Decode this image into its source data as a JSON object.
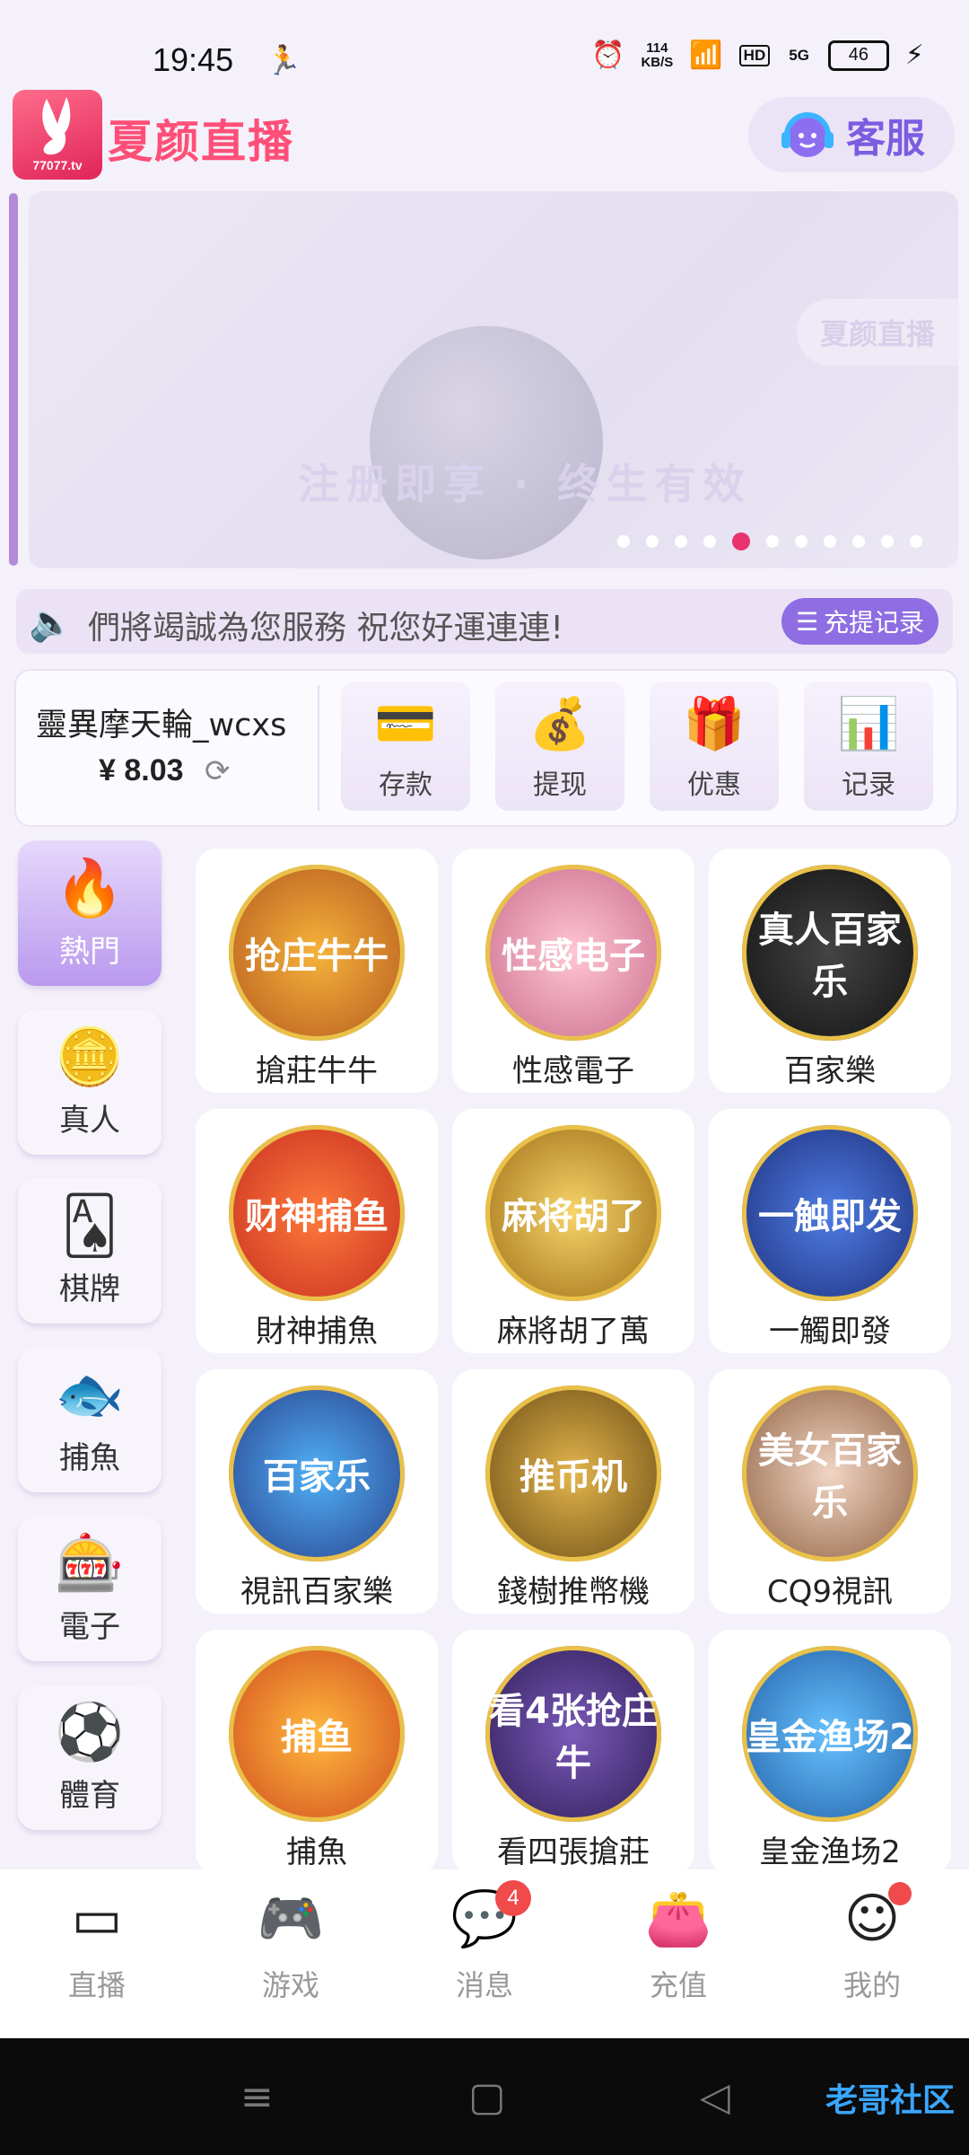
{
  "status_bar": {
    "time": "19:45",
    "net_speed": "114",
    "net_unit": "KB/S",
    "hd": "HD",
    "signal": "5G",
    "battery": "46"
  },
  "header": {
    "app_name": "夏颜直播",
    "logo_site": "77077.tv",
    "customer_service": "客服"
  },
  "banner": {
    "tagline": "注册即享 · 终生有效",
    "tag": "夏颜直播",
    "dot_count": 11,
    "active_dot": 4
  },
  "notice": {
    "text": "們將竭誠為您服務 祝您好運連連!",
    "records_button": "充提记录"
  },
  "wallet": {
    "username": "靈異摩天輪_wcxs",
    "balance": "¥ 8.03",
    "actions": [
      {
        "label": "存款",
        "icon": "card-icon"
      },
      {
        "label": "提现",
        "icon": "money-bag-icon"
      },
      {
        "label": "优惠",
        "icon": "gift-icon"
      },
      {
        "label": "记录",
        "icon": "bar-chart-icon"
      }
    ]
  },
  "sidebar": {
    "items": [
      {
        "label": "熱門",
        "icon": "flame-icon",
        "active": true
      },
      {
        "label": "真人",
        "icon": "chip-icon"
      },
      {
        "label": "棋牌",
        "icon": "playing-card-icon"
      },
      {
        "label": "捕魚",
        "icon": "fish-icon"
      },
      {
        "label": "電子",
        "icon": "slot-icon"
      },
      {
        "label": "體育",
        "icon": "soccer-ball-icon"
      }
    ]
  },
  "games": [
    {
      "name": "搶莊牛牛",
      "badge": "抢庄牛牛"
    },
    {
      "name": "性感電子",
      "badge": "性感电子"
    },
    {
      "name": "百家樂",
      "badge": "真人百家乐"
    },
    {
      "name": "財神捕魚",
      "badge": "财神捕鱼"
    },
    {
      "name": "麻將胡了萬",
      "badge": "麻将胡了"
    },
    {
      "name": "一觸即發",
      "badge": "一触即发"
    },
    {
      "name": "視訊百家樂",
      "badge": "百家乐"
    },
    {
      "name": "錢樹推幣機",
      "badge": "推币机"
    },
    {
      "name": "CQ9視訊",
      "badge": "美女百家乐"
    },
    {
      "name": "捕魚",
      "badge": "捕鱼"
    },
    {
      "name": "看四張搶莊",
      "badge": "看4张抢庄牛"
    },
    {
      "name": "皇金渔场2",
      "badge": "皇金渔场2"
    }
  ],
  "bottom_nav": {
    "items": [
      {
        "label": "直播",
        "icon": "camera-icon"
      },
      {
        "label": "游戏",
        "icon": "gamepad-icon"
      },
      {
        "label": "消息",
        "icon": "chat-icon",
        "badge": "4"
      },
      {
        "label": "充值",
        "icon": "wallet-icon"
      },
      {
        "label": "我的",
        "icon": "smiley-icon",
        "dot": true
      }
    ]
  },
  "system_bar": {
    "watermark": "老哥社区"
  }
}
